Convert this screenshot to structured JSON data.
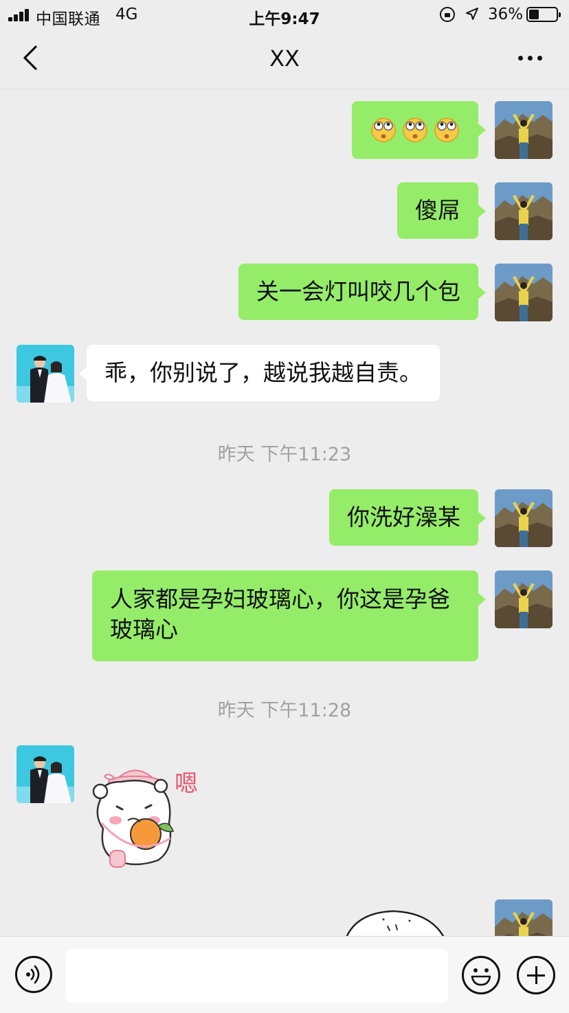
{
  "status_bar": {
    "carrier": "中国联通",
    "network": "4G",
    "time": "上午9:47",
    "battery": "36%",
    "battery_level": 0.36
  },
  "header": {
    "title": "XX"
  },
  "messages": [
    {
      "side": "me",
      "emoji": [
        "eyes-up-emoji",
        "eyes-up-emoji",
        "eyes-up-emoji"
      ]
    },
    {
      "side": "me",
      "text": "傻屌"
    },
    {
      "side": "me",
      "text": "关一会灯叫咬几个包"
    },
    {
      "side": "them",
      "text": "乖，你别说了，越说我越自责。"
    },
    {
      "timestamp": "昨天 下午11:23"
    },
    {
      "side": "me",
      "text": "你洗好澡某"
    },
    {
      "side": "me",
      "text": "人家都是孕妇玻璃心，你这是孕爸玻璃心"
    },
    {
      "timestamp": "昨天 下午11:28"
    },
    {
      "side": "them",
      "sticker": "hamster-eating-orange-sticker",
      "sticker_text": "嗯"
    },
    {
      "side": "me",
      "sticker": "round-face-sticker"
    }
  ],
  "input": {
    "placeholder": ""
  },
  "colors": {
    "background": "#ededed",
    "my_bubble": "#95ec69",
    "their_bubble": "#ffffff",
    "timestamp": "#a2a2a2"
  }
}
